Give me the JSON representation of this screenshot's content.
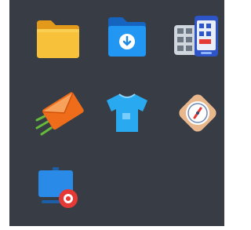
{
  "drawer": {
    "background": "#383d45",
    "apps": [
      {
        "icon": "yellow-folder-icon",
        "color": "#f5b82e"
      },
      {
        "icon": "download-folder-icon",
        "color": "#1e88e5"
      },
      {
        "icon": "keypad-phone-icon",
        "color": "#3f6fd8"
      },
      {
        "icon": "mail-envelope-icon",
        "color": "#ef6c1a"
      },
      {
        "icon": "tshirt-icon",
        "color": "#29a9ef"
      },
      {
        "icon": "compass-badge-icon",
        "color": "#e9b78c"
      },
      {
        "icon": "screen-record-icon",
        "color": "#2a8ae8"
      }
    ]
  }
}
